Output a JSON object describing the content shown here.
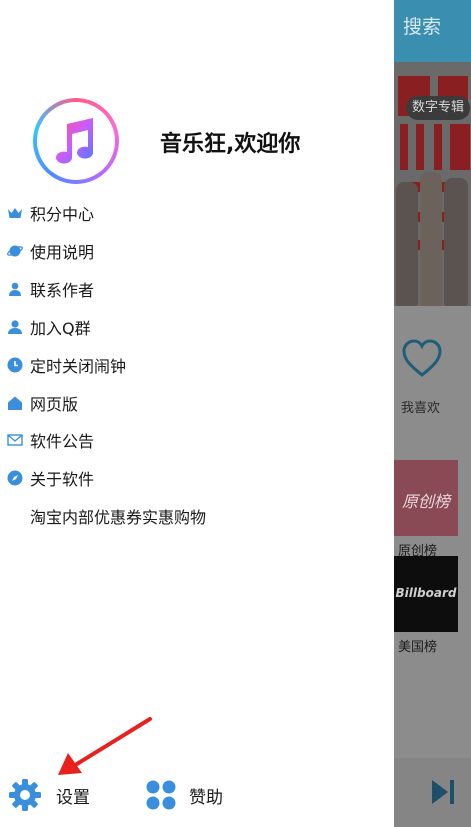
{
  "background_app": {
    "search_label": "搜索",
    "banner_tag": "数字专辑",
    "favorite_label": "我喜欢",
    "chart_original_label": "原创榜",
    "chart_original_cover_text": "原创榜",
    "chart_us_label": "美国榜",
    "chart_us_cover_text": "Billboard",
    "header_color": "#3a8fb0"
  },
  "drawer": {
    "welcome_text": "音乐狂,欢迎你",
    "avatar_icon": "music-note-icon",
    "menu": [
      {
        "label": "积分中心",
        "icon": "crown-icon"
      },
      {
        "label": "使用说明",
        "icon": "planet-icon"
      },
      {
        "label": "联系作者",
        "icon": "person-icon"
      },
      {
        "label": "加入Q群",
        "icon": "group-icon"
      },
      {
        "label": "定时关闭闹钟",
        "icon": "clock-icon"
      },
      {
        "label": "网页版",
        "icon": "home-icon"
      },
      {
        "label": "软件公告",
        "icon": "mail-icon"
      },
      {
        "label": "关于软件",
        "icon": "compass-icon"
      },
      {
        "label": "淘宝内部优惠券实惠购物",
        "icon": ""
      }
    ],
    "settings_label": "设置",
    "sponsor_label": "赞助",
    "accent_color": "#3a8fdd",
    "arrow_color": "#e8211c"
  }
}
